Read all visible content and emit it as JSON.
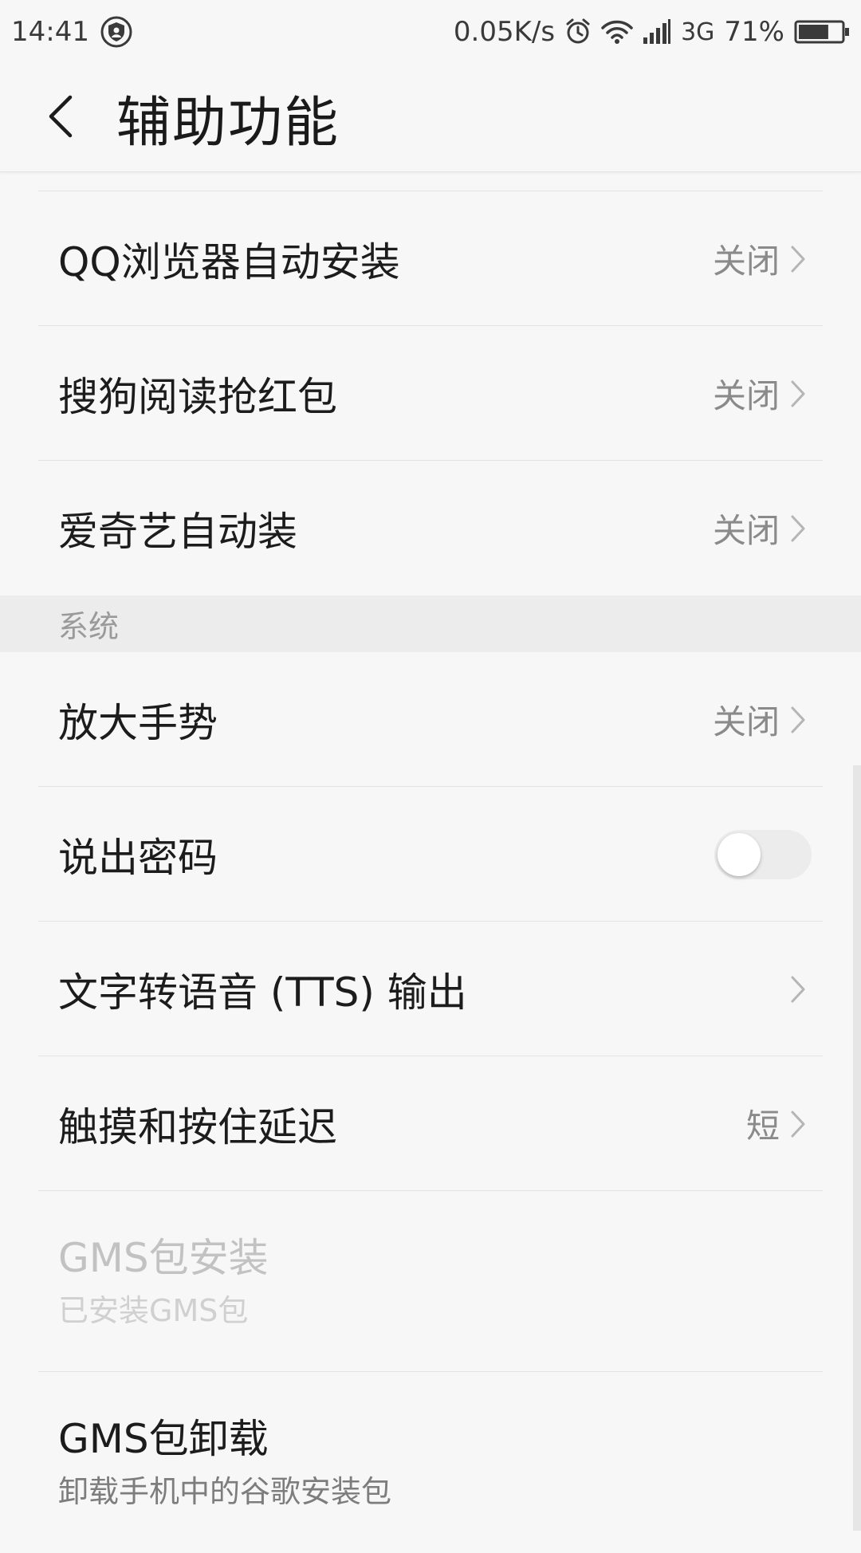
{
  "status_bar": {
    "time": "14:41",
    "net_speed": "0.05K/s",
    "network_type": "3G",
    "battery": "71%",
    "battery_level": 0.71,
    "icons": [
      "shield-icon",
      "alarm-icon",
      "wifi-icon",
      "signal-icon",
      "battery-icon"
    ]
  },
  "header": {
    "title": "辅助功能",
    "back_icon": "back-arrow-icon"
  },
  "apps_section": {
    "items": [
      {
        "label": "QQ浏览器自动安装",
        "value": "关闭"
      },
      {
        "label": "搜狗阅读抢红包",
        "value": "关闭"
      },
      {
        "label": "爱奇艺自动装",
        "value": "关闭"
      }
    ]
  },
  "system_section": {
    "header": "系统",
    "items": [
      {
        "label": "放大手势",
        "value": "关闭"
      },
      {
        "label": "说出密码",
        "toggle_on": false
      },
      {
        "label": "文字转语音 (TTS) 输出"
      },
      {
        "label": "触摸和按住延迟",
        "value": "短"
      },
      {
        "label": "GMS包安装",
        "subtitle": "已安装GMS包",
        "disabled": true
      },
      {
        "label": "GMS包卸载",
        "subtitle": "卸载手机中的谷歌安装包"
      }
    ]
  },
  "colors": {
    "background": "#f7f7f7",
    "section_header_bg": "#ececec",
    "divider": "#e3e3e3",
    "secondary_text": "#8a8a8a"
  }
}
